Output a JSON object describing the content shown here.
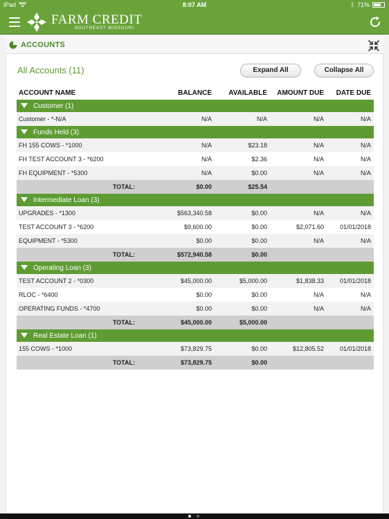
{
  "status_bar": {
    "device": "iPad",
    "time": "8:07 AM",
    "battery": "71%",
    "battery_level": 0.71
  },
  "header": {
    "brand": "FARM CREDIT",
    "sub": "SOUTHEAST MISSOURI",
    "accent_color": "#6aa33a"
  },
  "section": {
    "title": "ACCOUNTS"
  },
  "panel": {
    "title": "All Accounts (11)",
    "expand_label": "Expand All",
    "collapse_label": "Collapse All"
  },
  "table": {
    "columns": [
      "ACCOUNT NAME",
      "BALANCE",
      "AVAILABLE",
      "AMOUNT DUE",
      "DATE DUE"
    ],
    "groups": [
      {
        "name": "Customer (1)",
        "rows": [
          [
            "Customer - *-N/A",
            "N/A",
            "N/A",
            "N/A",
            "N/A"
          ]
        ],
        "total": null
      },
      {
        "name": "Funds Held (3)",
        "rows": [
          [
            "FH 155 COWS - *1000",
            "N/A",
            "$23.18",
            "N/A",
            "N/A"
          ],
          [
            "FH TEST ACCOUNT 3 - *6200",
            "N/A",
            "$2.36",
            "N/A",
            "N/A"
          ],
          [
            "FH EQUIPMENT - *5300",
            "N/A",
            "$0.00",
            "N/A",
            "N/A"
          ]
        ],
        "total": {
          "label": "TOTAL:",
          "balance": "$0.00",
          "available": "$25.54"
        }
      },
      {
        "name": "Intermediate Loan (3)",
        "rows": [
          [
            " UPGRADES - *1300",
            "$563,340.58",
            "$0.00",
            "N/A",
            "N/A"
          ],
          [
            "TEST ACCOUNT 3 - *6200",
            "$9,600.00",
            "$0.00",
            "$2,071.60",
            "01/01/2018"
          ],
          [
            "EQUIPMENT - *5300",
            "$0.00",
            "$0.00",
            "N/A",
            "N/A"
          ]
        ],
        "total": {
          "label": "TOTAL:",
          "balance": "$572,940.58",
          "available": "$0.00"
        }
      },
      {
        "name": "Operating Loan (3)",
        "rows": [
          [
            "TEST ACCOUNT 2 - *0300",
            "$45,000.00",
            "$5,000.00",
            "$1,838.33",
            "01/01/2018"
          ],
          [
            "RLOC - *6400",
            "$0.00",
            "$0.00",
            "N/A",
            "N/A"
          ],
          [
            "OPERATING FUNDS - *4700",
            "$0.00",
            "$0.00",
            "N/A",
            "N/A"
          ]
        ],
        "total": {
          "label": "TOTAL:",
          "balance": "$45,000.00",
          "available": "$5,000.00"
        }
      },
      {
        "name": "Real Estate Loan (1)",
        "rows": [
          [
            "155 COWS - *1000",
            "$73,829.75",
            "$0.00",
            "$12,805.52",
            "01/01/2018"
          ]
        ],
        "total": {
          "label": "TOTAL:",
          "balance": "$73,829.75",
          "available": "$0.00"
        }
      }
    ]
  }
}
